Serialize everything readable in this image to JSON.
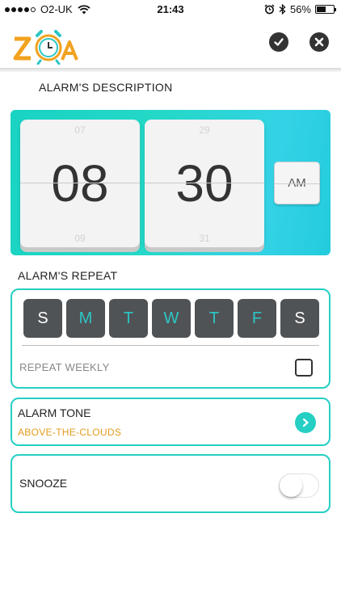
{
  "status_bar": {
    "carrier": "O2-UK",
    "time": "21:43",
    "battery": "56%",
    "battery_level": 0.56
  },
  "header": {
    "logo_icon": "zoa-alarm-clock-logo",
    "confirm_icon": "checkmark-icon",
    "close_icon": "close-icon"
  },
  "description_label": "ALARM'S DESCRIPTION",
  "time_picker": {
    "hour_prev": "07",
    "hour": "08",
    "hour_next": "09",
    "minute_prev": "29",
    "minute": "30",
    "minute_next": "31",
    "period": "AM"
  },
  "repeat": {
    "label": "ALARM'S REPEAT",
    "days": [
      {
        "label": "S",
        "selected": false
      },
      {
        "label": "M",
        "selected": true
      },
      {
        "label": "T",
        "selected": true
      },
      {
        "label": "W",
        "selected": true
      },
      {
        "label": "T",
        "selected": true
      },
      {
        "label": "F",
        "selected": true
      },
      {
        "label": "S",
        "selected": false
      }
    ],
    "weekly_label": "REPEAT WEEKLY",
    "weekly_checked": false
  },
  "tone": {
    "title": "ALARM TONE",
    "value": "ABOVE-THE-CLOUDS"
  },
  "snooze": {
    "title": "SNOOZE",
    "enabled": false
  },
  "colors": {
    "accent": "#25cfc3",
    "tone_value": "#e49b1c",
    "day_bg": "#505356",
    "day_selected_text": "#2cc6c6"
  }
}
